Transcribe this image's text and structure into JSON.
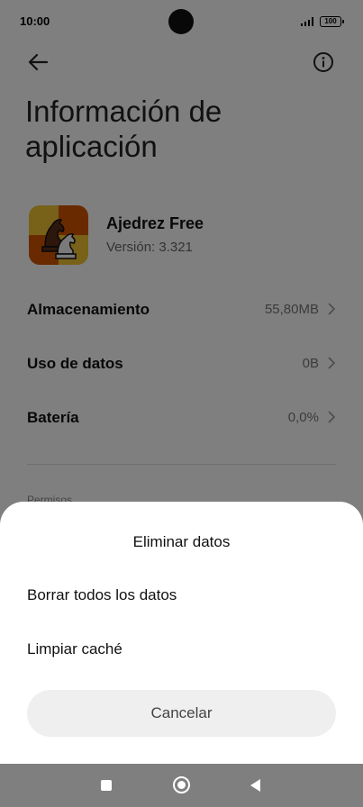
{
  "status": {
    "time": "10:00",
    "battery": "100"
  },
  "header": {
    "back_icon": "arrow-left-icon",
    "info_icon": "info-circle-icon",
    "title": "Información de aplicación"
  },
  "app": {
    "name": "Ajedrez Free",
    "version": "Versión: 3.321",
    "icon": "chess-knight-icon"
  },
  "rows": [
    {
      "label": "Almacenamiento",
      "value": "55,80MB"
    },
    {
      "label": "Uso de datos",
      "value": "0B"
    },
    {
      "label": "Batería",
      "value": "0,0%"
    }
  ],
  "section_peek": "Permisos",
  "sheet": {
    "title": "Eliminar datos",
    "items": [
      {
        "label": "Borrar todos los datos"
      },
      {
        "label": "Limpiar caché"
      }
    ],
    "cancel_label": "Cancelar"
  },
  "colors": {
    "scrim": "#000000",
    "sheet_bg": "#ffffff",
    "cancel_bg": "#efefef"
  }
}
